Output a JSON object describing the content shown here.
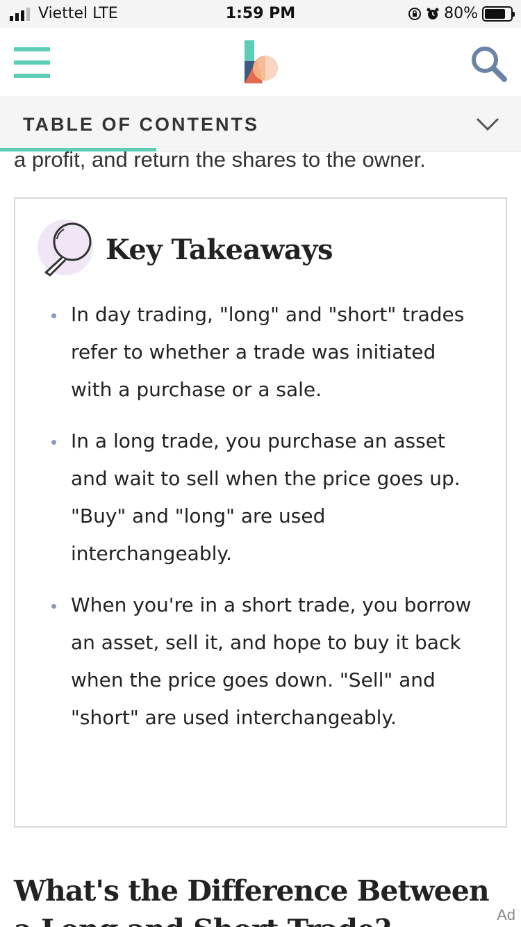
{
  "status_bar": {
    "carrier": "Viettel  LTE",
    "time": "1:59 PM",
    "battery_percent": "80%",
    "battery_level": 0.8
  },
  "header": {
    "menu_icon": "hamburger-menu-icon",
    "logo_icon": "brand-logo-icon",
    "search_icon": "search-icon",
    "accent_color": "#5ecdb7"
  },
  "toc": {
    "label": "TABLE OF CONTENTS",
    "chevron_icon": "chevron-down-icon",
    "progress": 0.3
  },
  "article": {
    "previous_text": "a profit, and return the shares to the owner.",
    "key_takeaways": {
      "title": "Key Takeaways",
      "icon": "magnifying-glass-icon",
      "items": [
        "In day trading, \"long\" and \"short\" trades refer to whether a trade was initiated with a purchase or a sale.",
        "In a long trade, you purchase an asset and wait to sell when the price goes up. \"Buy\" and \"long\" are used interchangeably.",
        "When you're in a short trade, you borrow an asset, sell it, and hope to buy it back when the price goes down. \"Sell\" and \"short\" are used interchangeably."
      ]
    },
    "section_heading": "What's the Difference Between a Long and Short Trade?"
  },
  "ad": {
    "label": "Ad"
  }
}
